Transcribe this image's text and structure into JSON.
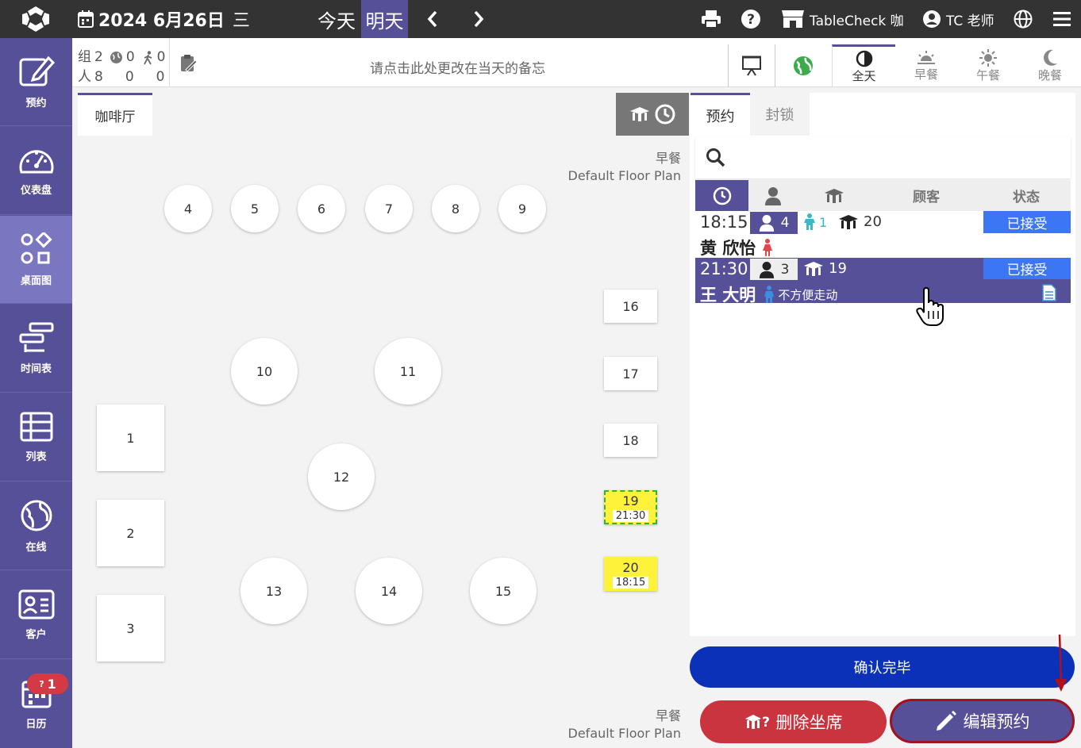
{
  "topbar": {
    "date_label": "2024 6月26日",
    "weekday": "三",
    "today_label": "今天",
    "tomorrow_label": "明天",
    "store_label": "TableCheck 咖",
    "user_label": "TC 老师"
  },
  "sidebar": {
    "items": [
      {
        "label": "预约",
        "icon": "edit-icon"
      },
      {
        "label": "仪表盘",
        "icon": "dashboard-icon"
      },
      {
        "label": "桌面图",
        "icon": "floorplan-icon"
      },
      {
        "label": "时间表",
        "icon": "timetable-icon"
      },
      {
        "label": "列表",
        "icon": "list-icon"
      },
      {
        "label": "在线",
        "icon": "globe-icon"
      },
      {
        "label": "客户",
        "icon": "customer-icon"
      },
      {
        "label": "日历",
        "icon": "calendar-icon"
      }
    ],
    "calendar_badge": "1"
  },
  "info": {
    "groups_label": "组",
    "groups": "2",
    "online_groups": "0",
    "walkin_groups": "0",
    "people_label": "人",
    "people": "8",
    "online_people": "0",
    "walkin_people": "0",
    "memo_placeholder": "请点击此处更改在当天的备忘",
    "meal_tabs": [
      "全天",
      "早餐",
      "午餐",
      "晚餐"
    ]
  },
  "floor": {
    "tab_label": "咖啡厅",
    "meal_label": "早餐",
    "plan_label": "Default Floor Plan",
    "tables": [
      "1",
      "2",
      "3",
      "4",
      "5",
      "6",
      "7",
      "8",
      "9",
      "10",
      "11",
      "12",
      "13",
      "14",
      "15",
      "16",
      "17",
      "18",
      "19",
      "20"
    ],
    "table19_time": "21:30",
    "table20_time": "18:15"
  },
  "panel": {
    "tab_reservations": "预约",
    "tab_block": "封锁",
    "col_customer": "顾客",
    "col_status": "状态",
    "reservations": [
      {
        "time": "18:15",
        "people": "4",
        "kids": "1",
        "table": "20",
        "name": "黄 欣怡",
        "status": "已接受"
      },
      {
        "time": "21:30",
        "people": "3",
        "table": "19",
        "name": "王 大明",
        "note": "不方便走动",
        "status": "已接受"
      }
    ],
    "confirm_label": "确认完毕",
    "delete_label": "删除坐席",
    "edit_label": "编辑预约"
  },
  "colors": {
    "accent": "#555097",
    "status_blue": "#3d76f5",
    "confirm_blue": "#0a31b8",
    "delete_red": "#c9343f",
    "highlight_yellow": "#fff23a"
  }
}
